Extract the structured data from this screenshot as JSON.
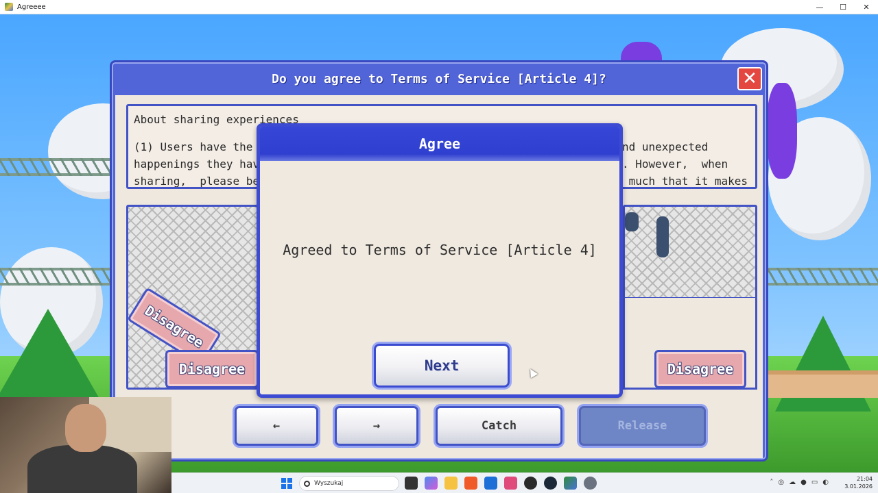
{
  "window": {
    "title": "Agreeee",
    "controls": {
      "minimize": "—",
      "maximize": "☐",
      "close": "✕"
    }
  },
  "dialog": {
    "title": "Do you agree to Terms of Service [Article 4]?",
    "close_symbol": "✕",
    "terms": {
      "heading": "About sharing experiences",
      "line1": "(1) Users have the r",
      "line1_right": "nd unexpected",
      "line2": "happenings they have",
      "line2_right": ". However,  when",
      "line3": "sharing,  please be",
      "line3_right": " much that it makes"
    },
    "disagree_tilted": "Disagree",
    "disagree_left": "Disagree",
    "disagree_right": "Disagree",
    "nav": {
      "back": "←",
      "forward": "→",
      "catch": "Catch",
      "release": "Release"
    }
  },
  "popup": {
    "title": "Agree",
    "message": "Agreed to Terms of Service [Article 4]",
    "next_label": "Next"
  },
  "taskbar": {
    "search_placeholder": "Wyszukaj",
    "time": "21:04",
    "date": "3.01.2026"
  },
  "colors": {
    "dialog_border": "#4253c6",
    "popup_header": "#3647d8",
    "close_button": "#e4473f",
    "disagree_fill": "#e7a8ad",
    "release_disabled": "#6e86c6"
  },
  "icons": [
    "windows-logo-icon",
    "search-icon",
    "file-explorer-icon",
    "brave-icon",
    "steam-icon",
    "settings-icon",
    "wifi-icon",
    "volume-icon"
  ]
}
